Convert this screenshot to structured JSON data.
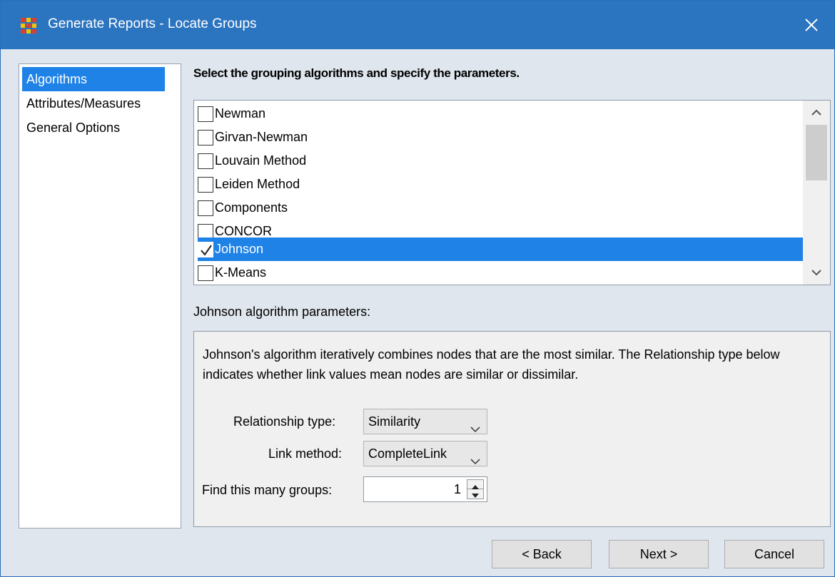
{
  "window": {
    "title": "Generate Reports - Locate Groups",
    "app_icon": "ora-grid-icon",
    "close_icon": "close-icon"
  },
  "nav": {
    "items": [
      {
        "label": "Algorithms",
        "selected": true
      },
      {
        "label": "Attributes/Measures",
        "selected": false
      },
      {
        "label": "General Options",
        "selected": false
      }
    ]
  },
  "main": {
    "heading": "Select the grouping algorithms and specify the parameters.",
    "algorithms": [
      {
        "label": "Newman",
        "checked": false
      },
      {
        "label": "Girvan-Newman",
        "checked": false
      },
      {
        "label": "Louvain Method",
        "checked": false
      },
      {
        "label": "Leiden Method",
        "checked": false
      },
      {
        "label": "Components",
        "checked": false
      },
      {
        "label": "CONCOR",
        "checked": false
      },
      {
        "label": "Johnson",
        "checked": true
      },
      {
        "label": "K-Means",
        "checked": false
      }
    ],
    "params_label": "Johnson algorithm parameters:",
    "params": {
      "description": "Johnson's algorithm iteratively combines nodes that are the most similar. The Relationship type below indicates whether link values mean nodes are similar or dissimilar.",
      "relationship_type_label": "Relationship type:",
      "relationship_type_value": "Similarity",
      "link_method_label": "Link method:",
      "link_method_value": "CompleteLink",
      "groups_label": "Find this many groups:",
      "groups_value": "1"
    }
  },
  "buttons": {
    "back": "< Back",
    "next": "Next >",
    "cancel": "Cancel"
  },
  "colors": {
    "titlebar": "#2b74c0",
    "selection": "#1e82e6",
    "window_bg": "#dfe6ee"
  }
}
